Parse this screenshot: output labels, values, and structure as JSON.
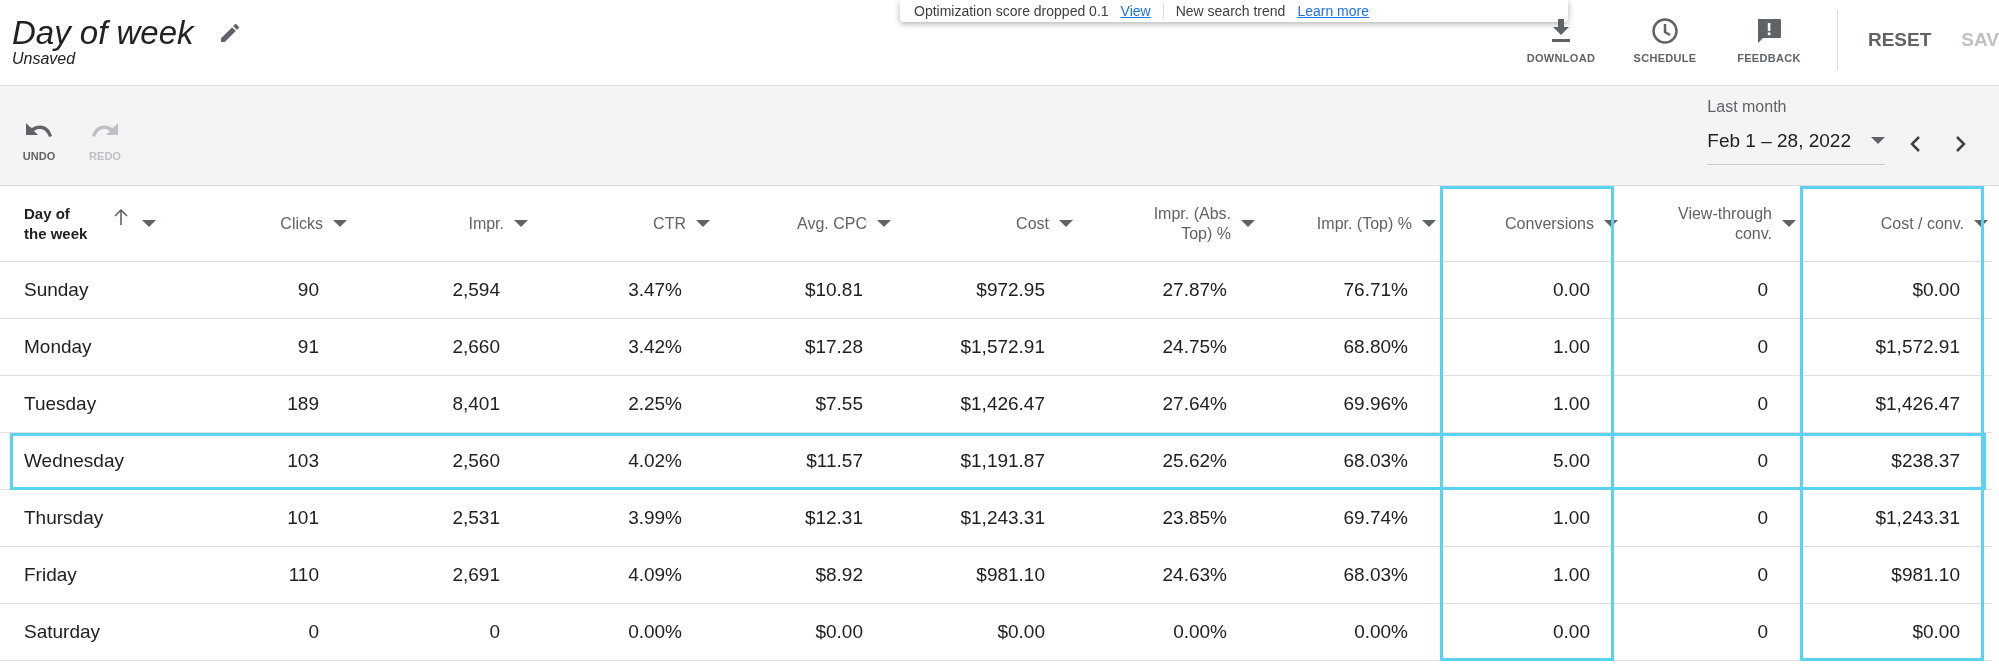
{
  "notice": {
    "items": [
      {
        "text": "Optimization score dropped 0.1",
        "link": "View"
      },
      {
        "text": "New search trend",
        "link": "Learn more"
      }
    ]
  },
  "header": {
    "title": "Day of week",
    "subtitle": "Unsaved",
    "actions": [
      {
        "kind": "download",
        "label": "DOWNLOAD"
      },
      {
        "kind": "schedule",
        "label": "SCHEDULE"
      },
      {
        "kind": "feedback",
        "label": "FEEDBACK"
      }
    ],
    "buttons": [
      {
        "label": "RESET",
        "disabled": false
      },
      {
        "label": "SAV",
        "disabled": true
      }
    ]
  },
  "toolbar": {
    "items": [
      {
        "kind": "undo",
        "label": "UNDO",
        "disabled": false
      },
      {
        "kind": "redo",
        "label": "REDO",
        "disabled": true
      }
    ],
    "date_range": {
      "label": "Last month",
      "value": "Feb 1 – 28, 2022"
    }
  },
  "table": {
    "columns": [
      {
        "label": "Day of the week",
        "sorted": true,
        "highlighted": false
      },
      {
        "label": "Clicks",
        "sorted": false,
        "highlighted": false
      },
      {
        "label": "Impr.",
        "sorted": false,
        "highlighted": false
      },
      {
        "label": "CTR",
        "sorted": false,
        "highlighted": false
      },
      {
        "label": "Avg. CPC",
        "sorted": false,
        "highlighted": false
      },
      {
        "label": "Cost",
        "sorted": false,
        "highlighted": false
      },
      {
        "label": "Impr. (Abs. Top) %",
        "sorted": false,
        "highlighted": false
      },
      {
        "label": "Impr. (Top) %",
        "sorted": false,
        "highlighted": false
      },
      {
        "label": "Conversions",
        "sorted": false,
        "highlighted": true
      },
      {
        "label": "View-through conv.",
        "sorted": false,
        "highlighted": false
      },
      {
        "label": "Cost / conv.",
        "sorted": false,
        "highlighted": true
      }
    ],
    "rows": [
      {
        "highlighted": false,
        "cells": [
          "Sunday",
          "90",
          "2,594",
          "3.47%",
          "$10.81",
          "$972.95",
          "27.87%",
          "76.71%",
          "0.00",
          "0",
          "$0.00"
        ]
      },
      {
        "highlighted": false,
        "cells": [
          "Monday",
          "91",
          "2,660",
          "3.42%",
          "$17.28",
          "$1,572.91",
          "24.75%",
          "68.80%",
          "1.00",
          "0",
          "$1,572.91"
        ]
      },
      {
        "highlighted": false,
        "cells": [
          "Tuesday",
          "189",
          "8,401",
          "2.25%",
          "$7.55",
          "$1,426.47",
          "27.64%",
          "69.96%",
          "1.00",
          "0",
          "$1,426.47"
        ]
      },
      {
        "highlighted": true,
        "cells": [
          "Wednesday",
          "103",
          "2,560",
          "4.02%",
          "$11.57",
          "$1,191.87",
          "25.62%",
          "68.03%",
          "5.00",
          "0",
          "$238.37"
        ]
      },
      {
        "highlighted": false,
        "cells": [
          "Thursday",
          "101",
          "2,531",
          "3.99%",
          "$12.31",
          "$1,243.31",
          "23.85%",
          "69.74%",
          "1.00",
          "0",
          "$1,243.31"
        ]
      },
      {
        "highlighted": false,
        "cells": [
          "Friday",
          "110",
          "2,691",
          "4.09%",
          "$8.92",
          "$981.10",
          "24.63%",
          "68.03%",
          "1.00",
          "0",
          "$981.10"
        ]
      },
      {
        "highlighted": false,
        "cells": [
          "Saturday",
          "0",
          "0",
          "0.00%",
          "$0.00",
          "$0.00",
          "0.00%",
          "0.00%",
          "0.00",
          "0",
          "$0.00"
        ]
      }
    ]
  }
}
